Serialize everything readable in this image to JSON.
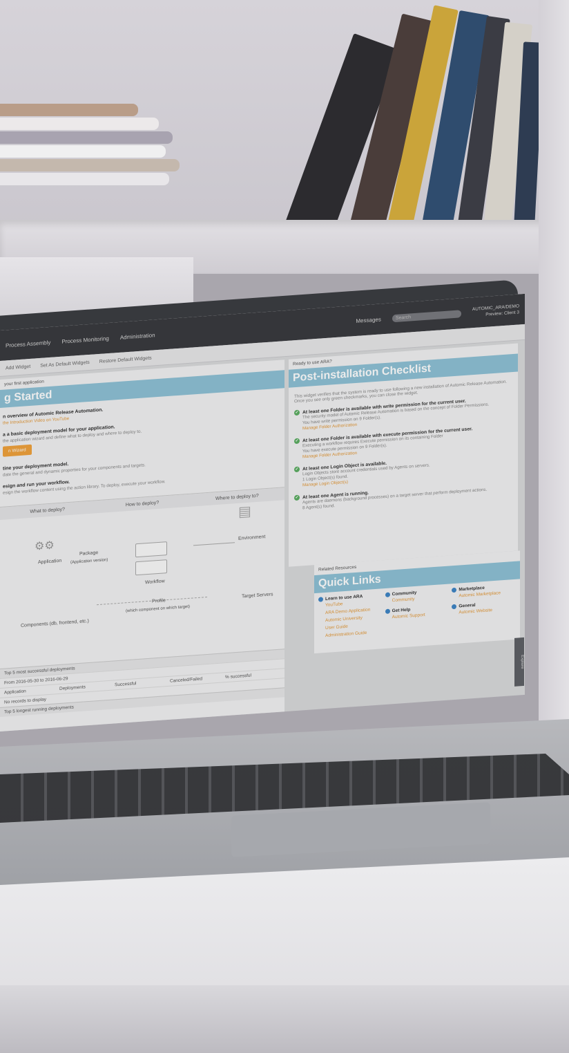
{
  "topbar": {
    "nav": [
      "Process Assembly",
      "Process Monitoring",
      "Administration"
    ],
    "messages": "Messages",
    "search_placeholder": "Search",
    "user_line1": "AUTOMIC_ARA/DEMO",
    "user_line2": "Preview: Client 3"
  },
  "toolbar": {
    "add_widget": "Add Widget",
    "set_default": "Set As Default Widgets",
    "restore_default": "Restore Default Widgets"
  },
  "getting_started": {
    "pretitle": "your first application",
    "title": "g Started",
    "step1_title": "n overview of Automic Release Automation.",
    "step1_link": "the Introduction Video on YouTube",
    "step2_title": "a a basic deployment model for your application.",
    "step2_text": "the application wizard and define what to deploy and where to deploy to.",
    "wizard_button": "n Wizard",
    "step3_title": "tine your deployment model.",
    "step3_text": "date the general and dynamic properties for your components and targets.",
    "step4_title": "esign and run your workflow.",
    "step4_text": "esign the workflow content using the action library. To deploy, execute your workflow."
  },
  "diagram": {
    "col1": "What to deploy?",
    "col2": "How to deploy?",
    "col3": "Where to deploy to?",
    "application": "Application",
    "package": "Package",
    "package_sub": "(Application version)",
    "environment": "Environment",
    "workflow": "Workflow",
    "profile": "Profile",
    "profile_sub": "(which component on which target)",
    "components": "Components (db, frontend, etc.)",
    "target_servers": "Target Servers"
  },
  "deployments_table": {
    "title": "Top 5 most successful deployments",
    "range": "From 2016-05-30 to 2016-06-29",
    "columns": [
      "Application",
      "Deployments",
      "Successful",
      "Canceled/Failed",
      "% successful"
    ],
    "empty": "No records to display",
    "title2": "Top 5 longest running deployments"
  },
  "checklist": {
    "pretitle": "Ready to use ARA?",
    "title": "Post-installation Checklist",
    "intro": "This widget verifies that the system is ready to use following a new installation of Automic Release Automation. Once you see only green checkmarks, you can close the widget.",
    "items": [
      {
        "title": "At least one Folder is available with write permission for the current user.",
        "desc": "The security model of Automic Release Automation is based on the concept of Folder Permissions.",
        "desc2": "You have write permission on 9 Folder(s).",
        "link": "Manage Folder Authorization"
      },
      {
        "title": "At least one Folder is available with execute permission for the current user.",
        "desc": "Executing a workflow requires Execute permission on its containing Folder",
        "desc2": "You have execute permission on 9 Folder(s).",
        "link": "Manage Folder Authorization"
      },
      {
        "title": "At least one Login Object is available.",
        "desc": "Login Objects store account credentials used by Agents on servers.",
        "desc2": "1 Login Object(s) found.",
        "link": "Manage Login Object(s)"
      },
      {
        "title": "At least one Agent is running.",
        "desc": "Agents are daemons (background processes) on a target server that perform deployment actions.",
        "desc2": "8 Agent(s) found.",
        "link": ""
      }
    ]
  },
  "quick_links": {
    "pretitle": "Related Resources",
    "title": "Quick Links",
    "learn": "Learn to use ARA",
    "learn_links": [
      "YouTube",
      "ARA Demo Application",
      "Automic University",
      "User Guide",
      "Administration Guide"
    ],
    "community": "Community",
    "community_link": "Community",
    "get_help": "Get Help",
    "get_help_link": "Automic Support",
    "marketplace": "Marketplace",
    "marketplace_link": "Automic Marketplace",
    "general": "General",
    "general_link": "Automic Website",
    "explore": "Explore"
  },
  "colors": {
    "banner": "#8ec2d6",
    "accent_link": "#e39a3b",
    "success": "#5cae63",
    "info_dot": "#3f86c6"
  }
}
